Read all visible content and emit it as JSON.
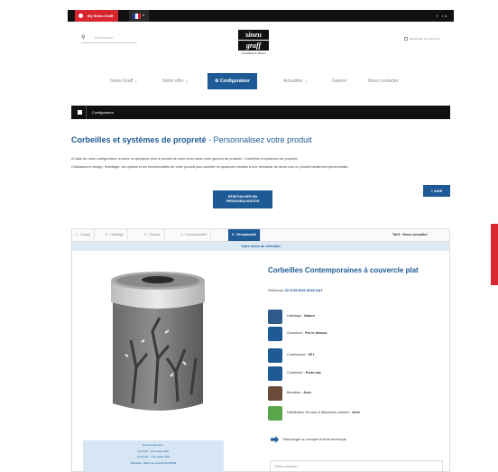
{
  "topbar": {
    "account_label": "My Sineu Graff",
    "social": "f in",
    "flag_colors": [
      "#1f3fa0",
      "#ffffff",
      "#d7262e"
    ]
  },
  "header": {
    "search_placeholder": "Rechercher",
    "logo_line1": "sineu",
    "logo_line2": "graff",
    "logo_tagline": "LE MOBILIER URBAIN",
    "quote_label": "DEMANDE DE DEVIS (0)"
  },
  "nav": {
    "items": [
      "Sineu Graff ⌄",
      "Notre offre ⌄",
      "Configurateur",
      "Actualités ⌄",
      "Galerie",
      "Nous contacter"
    ]
  },
  "breadcrumb": {
    "label": "Configurateur"
  },
  "page": {
    "title_bold": "Corbeilles et systèmes de propreté",
    "title_light": " - Personnalisez votre produit",
    "intro1": "A l'aide du notre configurateur, trouvez en quelques clics le produit de votre choix dans notre gamme de produits : Corbeilles et systèmes de propreté.",
    "intro2": "Choisissez le design, l'habillage, les options et les fonctionnalités de votre produit pour accéder en quelques minutes à une demande de devis pour un produit totalement personnalisé.",
    "reset_label_1": "RÉINITIALISER MA",
    "reset_label_2": "PERSONNALISATION",
    "help_label": "? AIDE"
  },
  "config": {
    "tabs": [
      "1 - Design",
      "2 - Habillage",
      "3 - Options",
      "4 - Fonctionnalités",
      "5 - Récapitulatif"
    ],
    "tarif": "Tarif : Nous consulter",
    "choice_banner": "Votre choix de sélection",
    "product_title": "Corbeilles Contemporaines à couvercle plat",
    "ref_label": "Référence",
    "ref_value": "20 0735 5001 B000 NAT",
    "options": [
      {
        "label": "Habillage : ",
        "value": "Nature",
        "color": "#2f5a8a"
      },
      {
        "label": "Ouverture : ",
        "value": "Par le dessus",
        "color": "#1e5a95"
      },
      {
        "label": "Contenance : ",
        "value": "95 L",
        "color": "#1e5a95"
      },
      {
        "label": "Contenant : ",
        "value": "Porte-sac",
        "color": "#1e5a95"
      },
      {
        "label": "Bandeau : ",
        "value": "Avec",
        "color": "#6b4a3a"
      },
      {
        "label": "Distributeur de sacs à déjections canines : ",
        "value": "Avec",
        "color": "#5aa64a"
      }
    ],
    "download_label": "Télécharger ou envoyer la fiche technique",
    "notes_label": "Textes conformes :",
    "info_lines": [
      "Textes présentés :",
      "Corbeille : Gris satiné 900,",
      "Couvercle : Gris satiné 900,",
      "Bandeau : Blanc de sécurité Ral 9003"
    ]
  }
}
